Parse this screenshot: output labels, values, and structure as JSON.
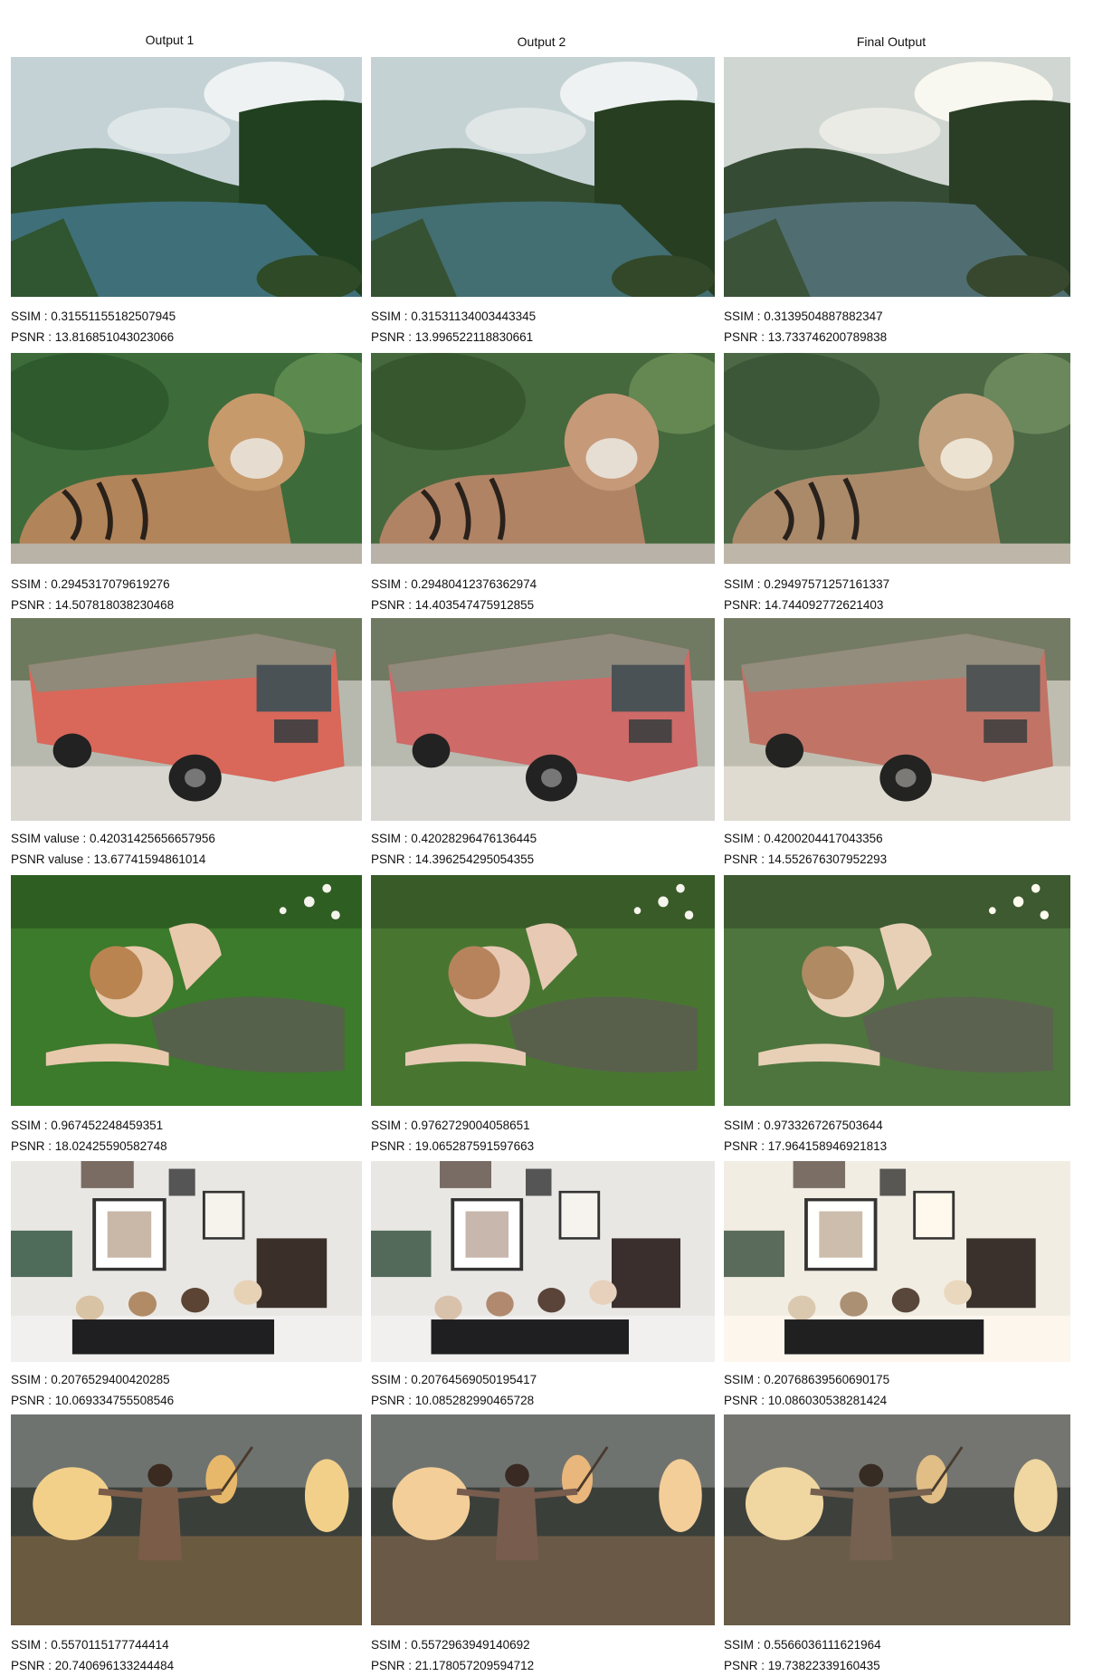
{
  "columns": [
    "Output 1",
    "Output 2",
    "Final Output"
  ],
  "rows": [
    {
      "scene": "river landscape with forested hills and cloudy sky",
      "metrics": [
        [
          "SSIM : 0.31551155182507945",
          "PSNR : 13.816851043023066"
        ],
        [
          "SSIM : 0.31531134003443345",
          "PSNR : 13.996522118830661"
        ],
        [
          "SSIM : 0.3139504887882347",
          "PSNR : 13.733746200789838"
        ]
      ]
    },
    {
      "scene": "tiger lying in front of green foliage",
      "metrics": [
        [
          "SSIM : 0.2945317079619276",
          "PSNR : 14.507818038230468"
        ],
        [
          "SSIM  : 0.29480412376362974",
          "PSNR : 14.403547475912855"
        ],
        [
          "SSIM : 0.29497571257161337",
          "PSNR: 14.744092772621403"
        ]
      ]
    },
    {
      "scene": "red and grey public bus on a street",
      "metrics": [
        [
          "SSIM valuse : 0.42031425656657956",
          "PSNR valuse : 13.67741594861014"
        ],
        [
          "SSIM : 0.42028296476136445",
          "PSNR : 14.396254295054355"
        ],
        [
          "SSIM : 0.4200204417043356",
          "PSNR : 14.552676307952293"
        ]
      ]
    },
    {
      "scene": "woman lying in grass with flowers",
      "metrics": [
        [
          "SSIM : 0.967452248459351",
          "PSNR : 18.02425590582748"
        ],
        [
          "SSIM : 0.9762729004058651",
          "PSNR : 19.065287591597663"
        ],
        [
          "SSIM : 0.9733267267503644",
          "PSNR : 17.964158946921813"
        ]
      ]
    },
    {
      "scene": "four people on a sofa in a room with framed art",
      "metrics": [
        [
          "SSIM : 0.2076529400420285",
          "PSNR : 10.069334755508546"
        ],
        [
          "SSIM : 0.20764569050195417",
          "PSNR : 10.085282990465728"
        ],
        [
          "SSIM : 0.20768639560690175",
          "PSNR : 10.086030538281424"
        ]
      ]
    },
    {
      "scene": "man with hat in a field with fires",
      "metrics": [
        [
          "SSIM : 0.5570115177744414",
          "PSNR : 20.740696133244484"
        ],
        [
          "SSIM : 0.5572963949140692",
          "PSNR : 21.178057209594712"
        ],
        [
          "SSIM : 0.5566036111621964",
          "PSNR : 19.73822339160435"
        ]
      ]
    }
  ],
  "palette": {
    "sky": "#c4d2d6",
    "hills": "#2c4d2c",
    "river": "#3f6f78",
    "foliage": "#3e6b3a",
    "tiger": "#b2845a",
    "bus_red": "#d9685a",
    "bus_top": "#8f8a7a",
    "grass": "#3c7a2c",
    "skin": "#e8c9ac",
    "wall": "#e9e7e3",
    "fire": "#f2d08a",
    "smoke": "#3a3f3a"
  }
}
